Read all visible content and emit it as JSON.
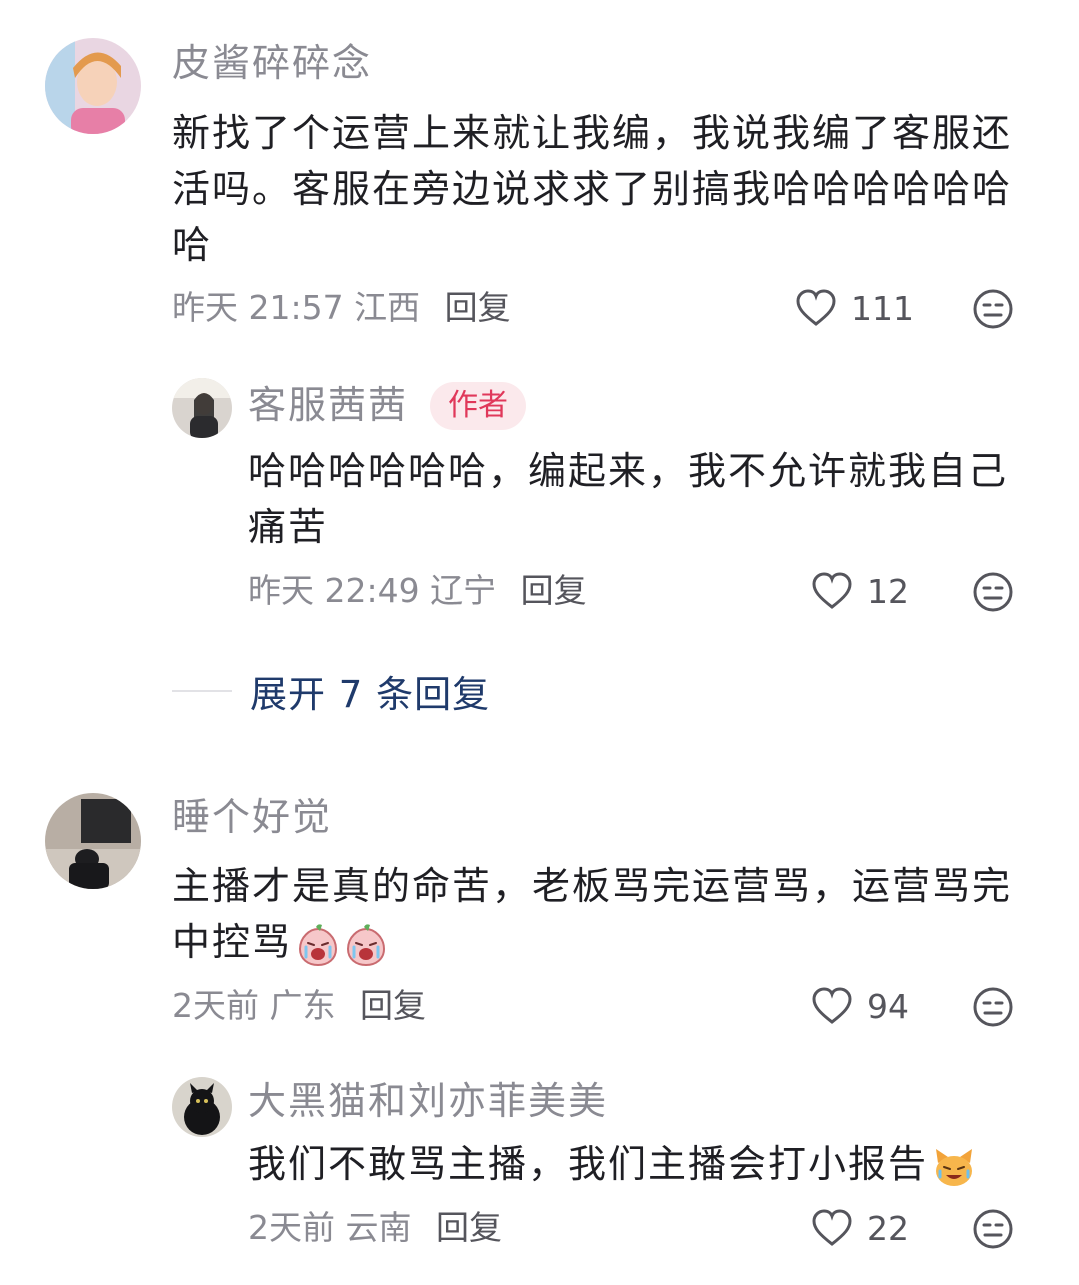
{
  "comments": [
    {
      "username": "皮酱碎碎念",
      "text": "新找了个运营上来就让我编，我说我编了客服还活吗。客服在旁边说求求了别搞我哈哈哈哈哈哈哈",
      "time": "昨天 21:57",
      "location": "江西",
      "reply_label": "回复",
      "likes": "111",
      "replies": [
        {
          "username": "客服茜茜",
          "badge": "作者",
          "text": "哈哈哈哈哈哈，编起来，我不允许就我自己痛苦",
          "time": "昨天 22:49",
          "location": "辽宁",
          "reply_label": "回复",
          "likes": "12"
        }
      ],
      "expand_label": "展开 7 条回复"
    },
    {
      "username": "睡个好觉",
      "text": "主播才是真的命苦，老板骂完运营骂，运营骂完中控骂",
      "time": "2天前",
      "location": "广东",
      "reply_label": "回复",
      "likes": "94",
      "replies": [
        {
          "username": "大黑猫和刘亦菲美美",
          "text": "我们不敢骂主播，我们主播会打小报告",
          "time": "2天前",
          "location": "云南",
          "reply_label": "回复",
          "likes": "22"
        }
      ]
    }
  ],
  "icons": {
    "like": "heart-outline-icon",
    "dislike": "neutral-face-icon",
    "emoji_crying": "crying-peach-emoji",
    "emoji_cat": "laughing-cat-emoji"
  },
  "colors": {
    "author_badge_bg": "#fbe9ec",
    "author_badge_text": "#e0385a",
    "expand_text": "#1f3a6b"
  }
}
